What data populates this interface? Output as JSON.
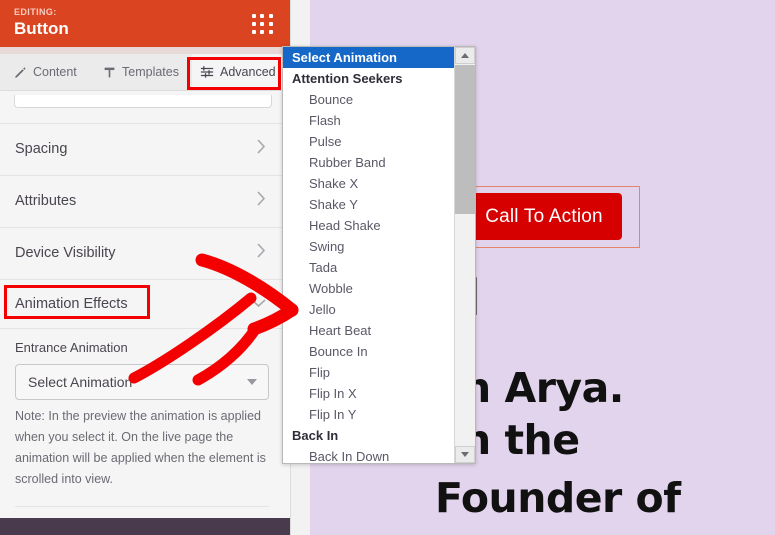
{
  "editor": {
    "header": {
      "eyebrow": "EDITING:",
      "title": "Button",
      "grid_icon": "grid-dots-icon",
      "bg_color": "#da4420"
    },
    "tabs": [
      {
        "label": "Content",
        "icon": "pencil-icon",
        "active": false
      },
      {
        "label": "Templates",
        "icon": "template-icon",
        "active": false
      },
      {
        "label": "Advanced",
        "icon": "sliders-icon",
        "active": true
      }
    ],
    "accordion_rows": [
      {
        "label": "Spacing",
        "chevron": "chevron-right"
      },
      {
        "label": "Attributes",
        "chevron": "chevron-right"
      },
      {
        "label": "Device Visibility",
        "chevron": "chevron-right"
      },
      {
        "label": "Animation Effects",
        "chevron": "chevron-down"
      }
    ],
    "entrance_animation": {
      "label": "Entrance Animation",
      "value": "Select Animation",
      "placeholder": "Select Animation",
      "caret_icon": "caret-down-icon"
    },
    "note": "Note: In the preview the animation is applied when you select it. On the live page the animation will be applied when the element is scrolled into view."
  },
  "dropdown": {
    "selected": "Select Animation",
    "scroll_up_icon": "triangle-up-icon",
    "scroll_down_icon": "triangle-down-icon",
    "items": [
      {
        "label": "Select Animation",
        "type": "selected"
      },
      {
        "label": "Attention Seekers",
        "type": "group"
      },
      {
        "label": "Bounce",
        "type": "option"
      },
      {
        "label": "Flash",
        "type": "option"
      },
      {
        "label": "Pulse",
        "type": "option"
      },
      {
        "label": "Rubber Band",
        "type": "option"
      },
      {
        "label": "Shake X",
        "type": "option"
      },
      {
        "label": "Shake Y",
        "type": "option"
      },
      {
        "label": "Head Shake",
        "type": "option"
      },
      {
        "label": "Swing",
        "type": "option"
      },
      {
        "label": "Tada",
        "type": "option"
      },
      {
        "label": "Wobble",
        "type": "option"
      },
      {
        "label": "Jello",
        "type": "option"
      },
      {
        "label": "Heart Beat",
        "type": "option"
      },
      {
        "label": "Bounce In",
        "type": "option"
      },
      {
        "label": "Flip",
        "type": "option"
      },
      {
        "label": "Flip In X",
        "type": "option"
      },
      {
        "label": "Flip In Y",
        "type": "option"
      },
      {
        "label": "Back In",
        "type": "group"
      },
      {
        "label": "Back In Down",
        "type": "option"
      }
    ]
  },
  "preview": {
    "background_color": "#e2d4ec",
    "cta_button": {
      "label": "Call To Action",
      "color": "#d60000",
      "text_color": "#ffffff"
    },
    "hero_lines": [
      "I",
      "n Arya.",
      "n the",
      "Founder of"
    ]
  },
  "annotations": {
    "color": "#f50000",
    "boxes": [
      "Advanced",
      "Animation Effects"
    ],
    "arrow": "red-arrow-pointing-right"
  }
}
